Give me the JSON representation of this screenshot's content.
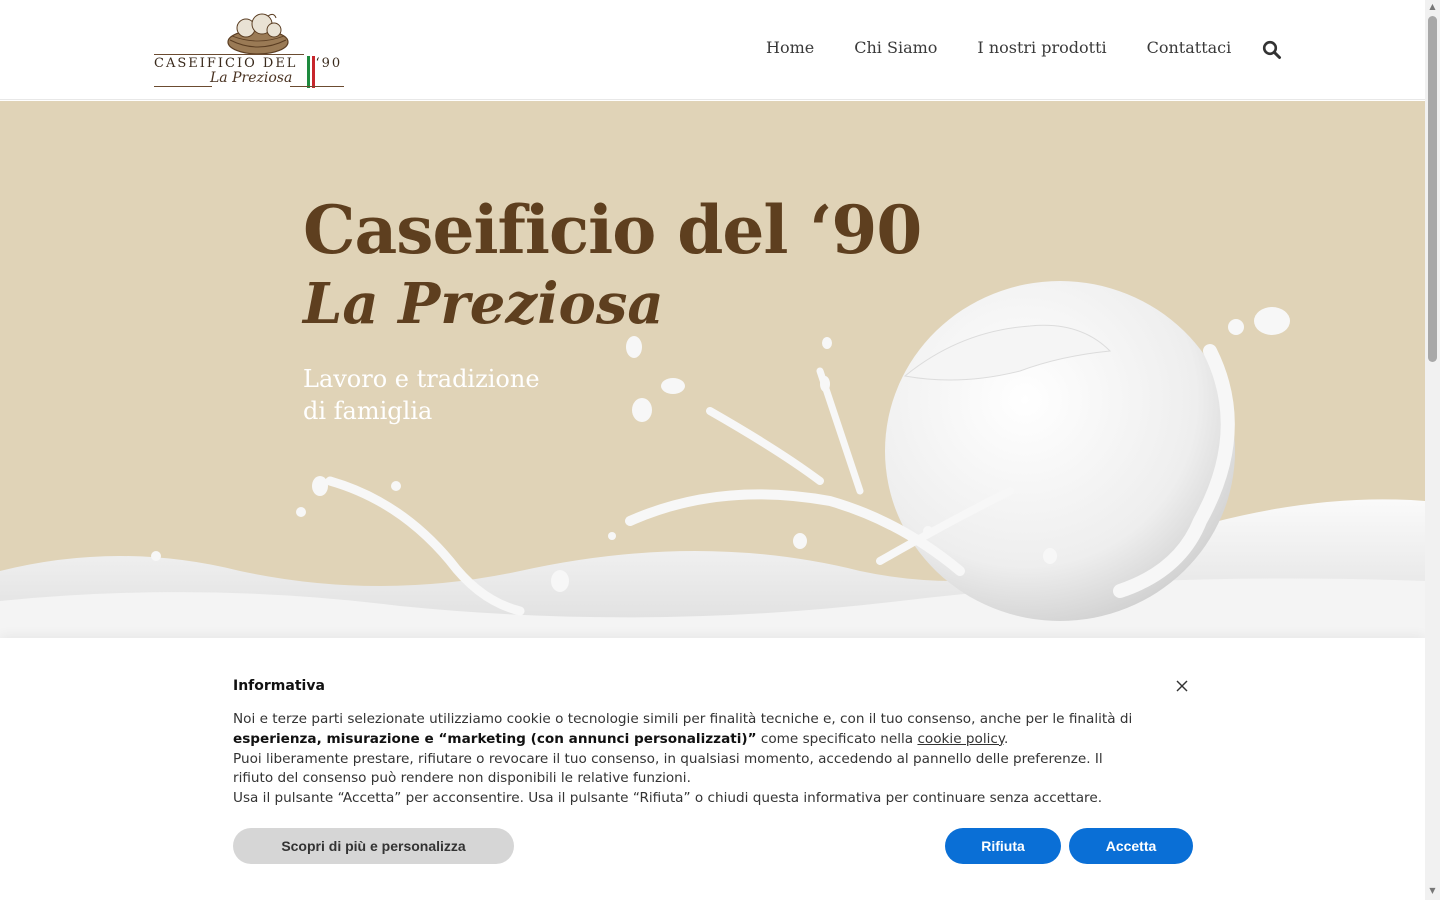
{
  "header": {
    "logo": {
      "line1": "CASEIFICIO DEL",
      "year": "‘90",
      "line2": "La Preziosa"
    },
    "nav": [
      {
        "label": "Home"
      },
      {
        "label": "Chi Siamo"
      },
      {
        "label": "I nostri prodotti"
      },
      {
        "label": "Contattaci"
      }
    ],
    "search_icon": "search-icon"
  },
  "hero": {
    "title": "Caseificio del ‘90",
    "script": "La Preziosa",
    "subtitle_line1": "Lavoro e tradizione",
    "subtitle_line2": "di famiglia",
    "background_color": "#e0d3b7",
    "title_color": "#5e3f1f"
  },
  "cookie_banner": {
    "title": "Informativa",
    "p1_a": "Noi e terze parti selezionate utilizziamo cookie o tecnologie simili per finalità tecniche e, con il tuo consenso, anche per le finalità di",
    "p1_bold": "esperienza, misurazione e “marketing (con annunci personalizzati)”",
    "p1_b": " come specificato nella ",
    "p1_link": "cookie policy",
    "p1_c": ".",
    "p2_line1": "Puoi liberamente prestare, rifiutare o revocare il tuo consenso, in qualsiasi momento, accedendo al pannello delle preferenze. Il",
    "p2_line2": "rifiuto del consenso può rendere non disponibili le relative funzioni.",
    "p3": "Usa il pulsante “Accetta” per acconsentire. Usa il pulsante “Rifiuta” o chiudi questa informativa per continuare senza accettare.",
    "btn_more": "Scopri di più e personalizza",
    "btn_reject": "Rifiuta",
    "btn_accept": "Accetta",
    "accent_color": "#0a6fd6",
    "close_icon": "close-icon"
  }
}
